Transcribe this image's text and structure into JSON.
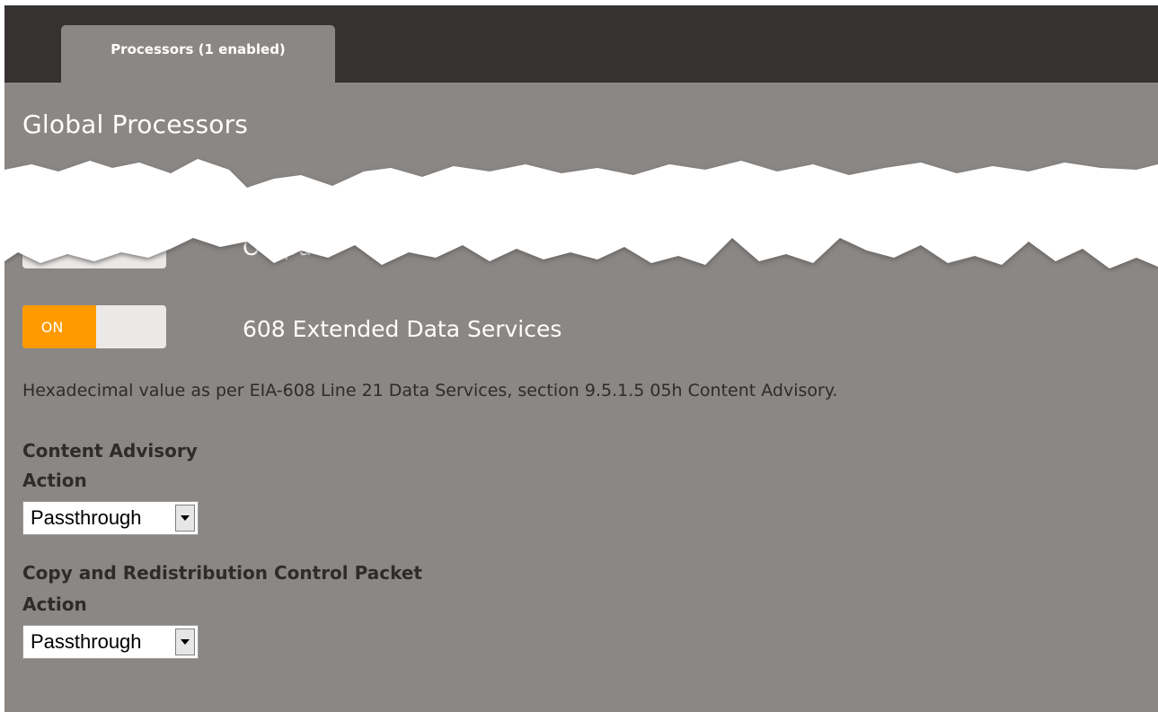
{
  "tab": {
    "label": "Processors (1 enabled)"
  },
  "page": {
    "title": "Global Processors"
  },
  "obscured_row": {
    "label_fragment": "Outpu"
  },
  "processor": {
    "toggle_label": "ON",
    "name": "608 Extended Data Services",
    "description": "Hexadecimal value as per EIA-608 Line 21 Data Services, section 9.5.1.5 05h Content Advisory."
  },
  "content_advisory": {
    "heading": "Content Advisory",
    "action_label": "Action",
    "selected": "Passthrough"
  },
  "copy_redistribution": {
    "heading": "Copy and Redistribution Control Packet",
    "action_label": "Action",
    "selected": "Passthrough"
  },
  "colors": {
    "panel": "#8a8785",
    "tabbar": "#353231",
    "toggle_on": "#ff9b00",
    "text_dark": "#2e2c2b"
  }
}
